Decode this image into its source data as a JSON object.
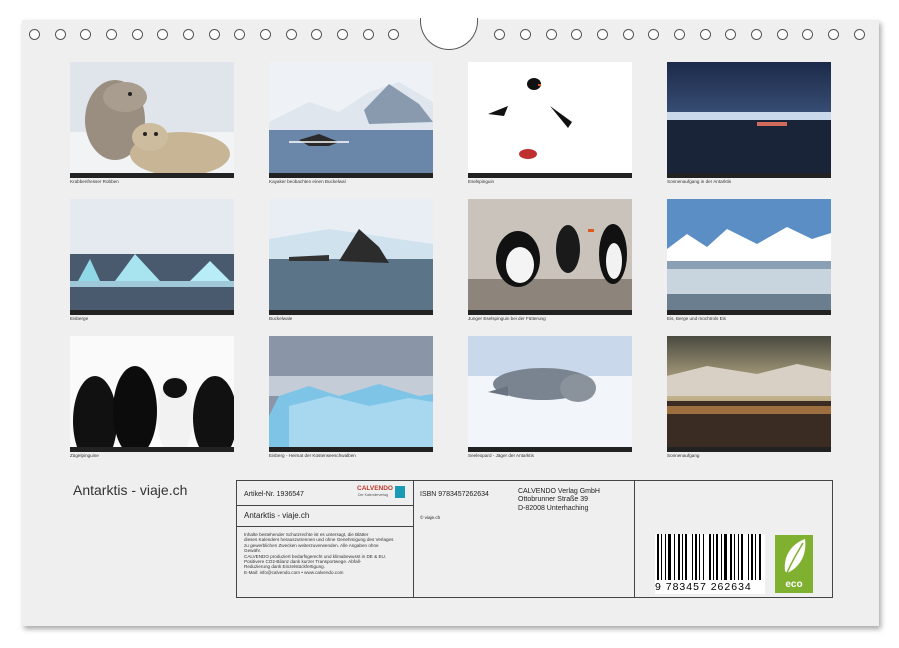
{
  "calendar": {
    "title": "Antarktis - viaje.ch",
    "photos": [
      {
        "caption": "Krabbenfresser Robben",
        "scene": "seals"
      },
      {
        "caption": "Kayaker beobachten einen Buckelwal",
        "scene": "whale-tail"
      },
      {
        "caption": "Eselspinguin",
        "scene": "penguin-white"
      },
      {
        "caption": "Sonnenaufgang in der Antarktis",
        "scene": "dawn-sea"
      },
      {
        "caption": "Eisberge",
        "scene": "icebergs"
      },
      {
        "caption": "Buckelwale",
        "scene": "humpback"
      },
      {
        "caption": "Junger Eselspinguin bei der Fütterung",
        "scene": "gentoo-feeding"
      },
      {
        "caption": "Eis, Berge und mochtrols Eis",
        "scene": "ice-mountains"
      },
      {
        "caption": "Zügelpinguine",
        "scene": "chinstrap"
      },
      {
        "caption": "Eisberg - Heimat der Küstenseeschwalben",
        "scene": "blue-iceberg"
      },
      {
        "caption": "Seeleopard - Jäger der Antarktis",
        "scene": "leopard-seal"
      },
      {
        "caption": "Sonnenaufgang",
        "scene": "sunrise"
      }
    ]
  },
  "info": {
    "article": "Artikel-Nr. 1936547",
    "publisher_logo": "CALVENDO",
    "publisher_tagline": "Der Kalenderverlag",
    "product_title": "Antarktis - viaje.ch",
    "legal_text": [
      "Inhalte bestehender Schutzrechte ist es untersagt, die Blätter",
      "dieses Kalenders herauszutrennen und ohne Genehmigung des Verlages",
      "zu gewerblichen Zwecken weiterzuverwenden. Alle Angaben ohne",
      "Gewähr.",
      "CALVENDO produziert bedarfsgerecht und klimabewusst in DE & EU.",
      "Positivere CO2-Bilanz dank kurzer Transportwege. Abfall-",
      "Reduzierung dank Einzelstückfertigung.",
      "E-Mail: info@calvendo.com • www.calvendo.com"
    ],
    "isbn": "ISBN 9783457262634",
    "copyright": "© viaje.ch",
    "address": [
      "CALVENDO Verlag GmbH",
      "Ottobrunner Straße 39",
      "D-82008 Unterhaching"
    ],
    "barcode_number": "9 783457 262634",
    "eco_label": "eco"
  }
}
